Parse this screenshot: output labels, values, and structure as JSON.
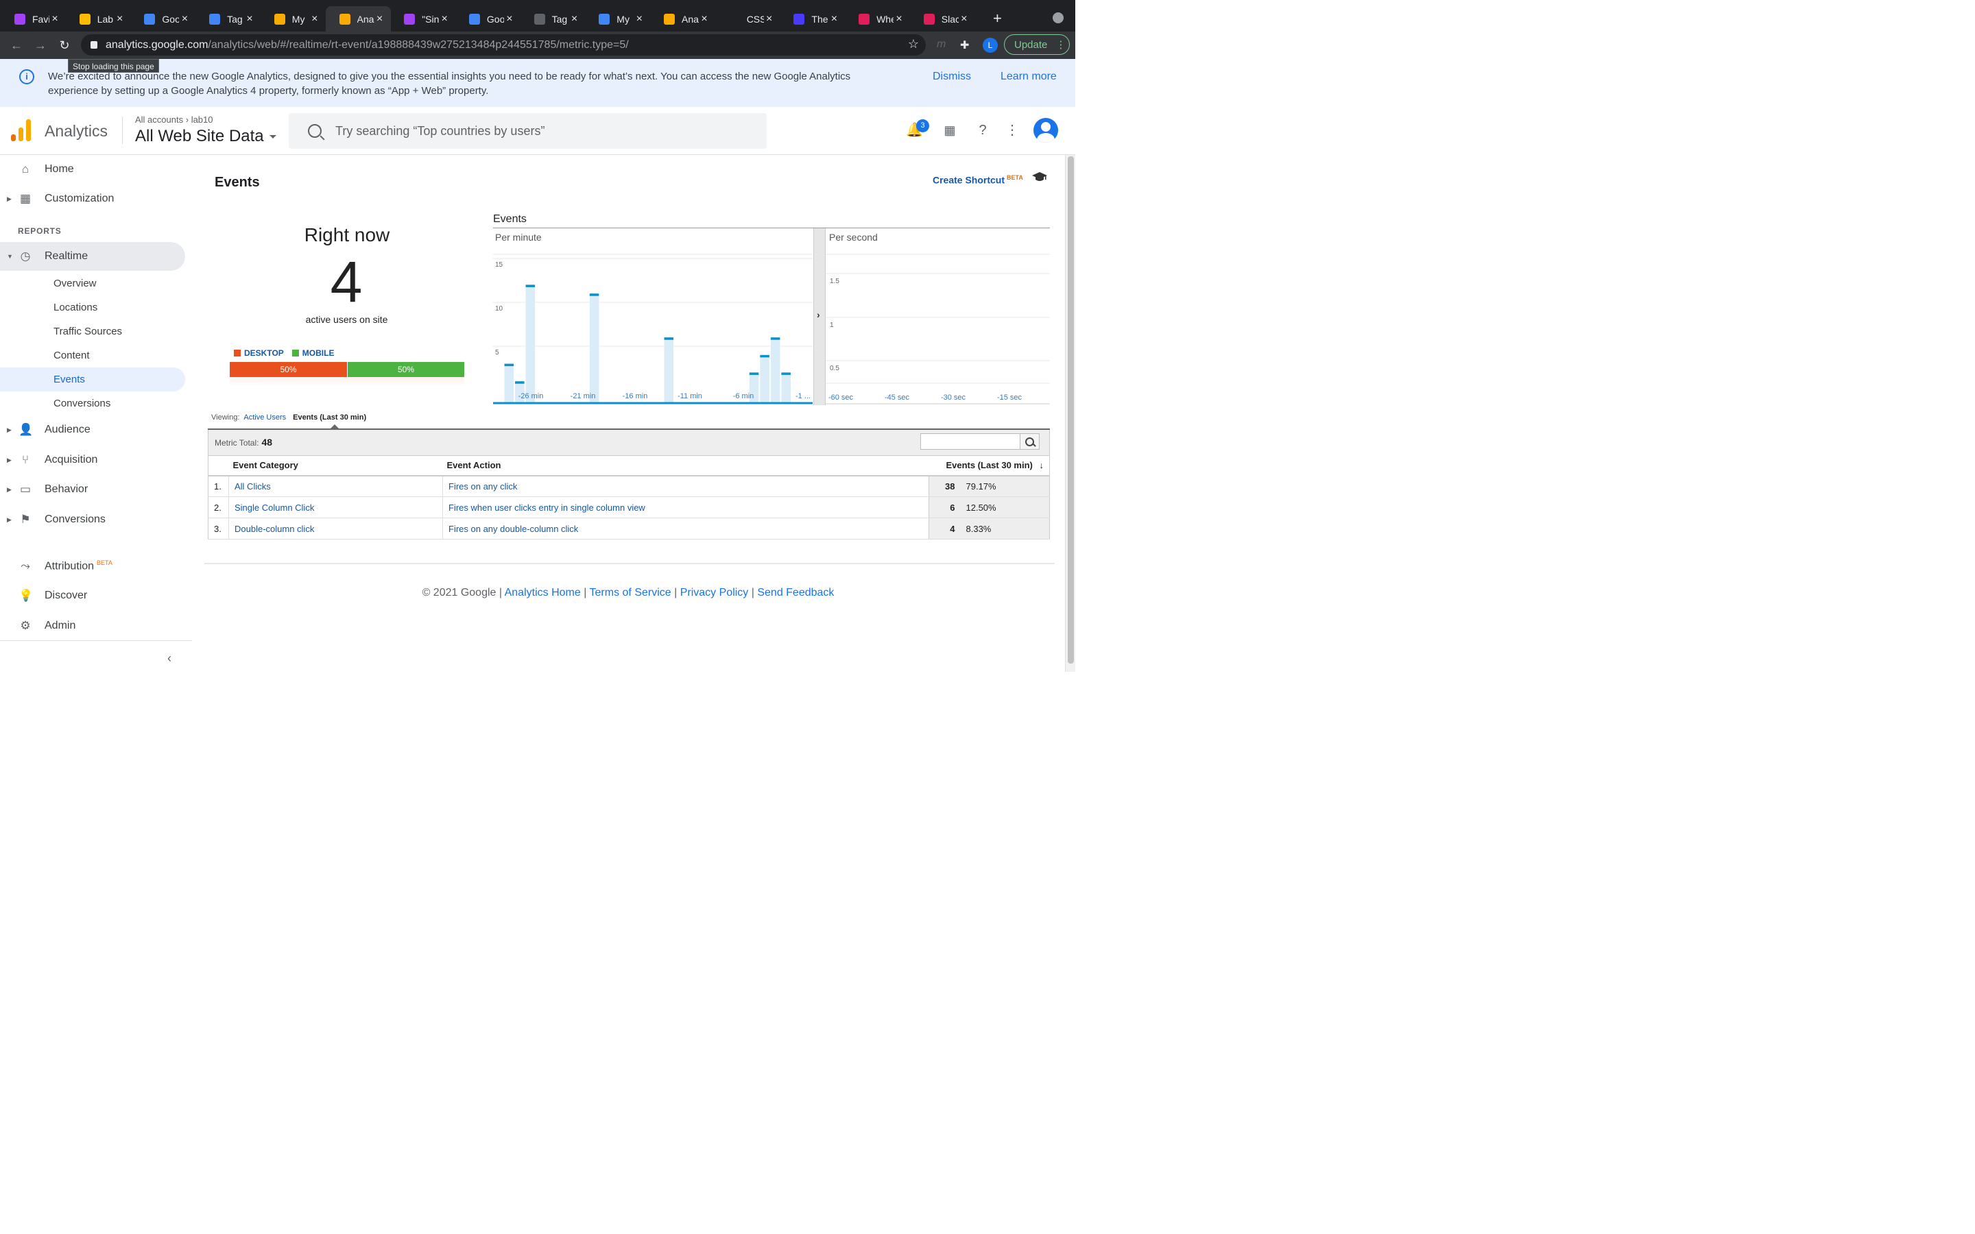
{
  "browser": {
    "tabs": [
      {
        "title": "Favi",
        "color": "#a142f4"
      },
      {
        "title": "Lab",
        "color": "#fbbc04"
      },
      {
        "title": "Goo",
        "color": "#4285f4"
      },
      {
        "title": "Tag",
        "color": "#4285f4"
      },
      {
        "title": "My",
        "color": "#f9ab00"
      },
      {
        "title": "Anal",
        "color": "#f9ab00",
        "active": true
      },
      {
        "title": "\"Sin",
        "color": "#a142f4"
      },
      {
        "title": "Goo",
        "color": "#4285f4"
      },
      {
        "title": "Tag",
        "color": "#5f6368"
      },
      {
        "title": "My",
        "color": "#4285f4"
      },
      {
        "title": "Anal",
        "color": "#f9ab00"
      },
      {
        "title": "CSS",
        "color": "#202124"
      },
      {
        "title": "The",
        "color": "#4a3aff"
      },
      {
        "title": "Whe",
        "color": "#e01e5a"
      },
      {
        "title": "Slac",
        "color": "#e01e5a"
      }
    ],
    "url_host": "analytics.google.com",
    "url_path": "/analytics/web/#/realtime/rt-event/a198888439w275213484p244551785/metric.type=5/",
    "tooltip": "Stop loading this page",
    "profile_initial": "L",
    "update_label": "Update"
  },
  "banner": {
    "text": "We’re excited to announce the new Google Analytics, designed to give you the essential insights you need to be ready for what’s next. You can access the new Google Analytics experience by setting up a Google Analytics 4 property, formerly known as “App + Web” property.",
    "dismiss": "Dismiss",
    "learn_more": "Learn more"
  },
  "header": {
    "product": "Analytics",
    "breadcrumb_root": "All accounts",
    "breadcrumb_account": "lab10",
    "property": "All Web Site Data",
    "search_placeholder": "Try searching “Top countries by users”",
    "notifications_count": "3"
  },
  "sidebar": {
    "home": "Home",
    "customization": "Customization",
    "reports_heading": "REPORTS",
    "realtime": "Realtime",
    "realtime_items": [
      "Overview",
      "Locations",
      "Traffic Sources",
      "Content",
      "Events",
      "Conversions"
    ],
    "selected": "Events",
    "audience": "Audience",
    "acquisition": "Acquisition",
    "behavior": "Behavior",
    "conversions": "Conversions",
    "attribution": "Attribution",
    "attribution_badge": "BETA",
    "discover": "Discover",
    "admin": "Admin"
  },
  "main": {
    "title": "Events",
    "create_shortcut": "Create Shortcut",
    "create_shortcut_badge": "BETA",
    "right_now": "Right now",
    "active_users": "4",
    "active_users_label": "active users on site",
    "device_legend": [
      {
        "label": "DESKTOP",
        "color": "#e8501e"
      },
      {
        "label": "MOBILE",
        "color": "#4db340"
      }
    ],
    "device_split": [
      {
        "label": "50%",
        "value": 50,
        "color": "#e8501e"
      },
      {
        "label": "50%",
        "value": 50,
        "color": "#4db340"
      }
    ],
    "viewing_label": "Viewing:",
    "viewing_link": "Active Users",
    "viewing_current": "Events (Last 30 min)",
    "metric_total_label": "Metric Total:",
    "metric_total": "48"
  },
  "chart_data": {
    "type": "bar",
    "title": "Events",
    "panes": [
      {
        "name": "Per minute",
        "y_ticks": [
          "15",
          "10",
          "5"
        ],
        "ylim": [
          0,
          15
        ],
        "x_labels": [
          "-26 min",
          "-21 min",
          "-16 min",
          "-11 min",
          "-6 min",
          "-1 ..."
        ],
        "values": [
          0,
          3,
          1,
          12,
          0,
          0,
          0,
          0,
          0,
          11,
          0,
          0,
          0,
          0,
          0,
          0,
          6,
          0,
          0,
          0,
          0,
          0,
          0,
          0,
          2,
          4,
          6,
          2,
          0,
          0
        ]
      },
      {
        "name": "Per second",
        "y_ticks": [
          "1.5",
          "1",
          "0.5"
        ],
        "ylim": [
          0,
          2
        ],
        "x_labels": [
          "-60 sec",
          "-45 sec",
          "-30 sec",
          "-15 sec"
        ],
        "values": []
      }
    ]
  },
  "table": {
    "columns": [
      "Event Category",
      "Event Action",
      "Events (Last 30 min)"
    ],
    "rows": [
      {
        "rank": "1.",
        "category": "All Clicks",
        "action": "Fires on any click",
        "events": "38",
        "pct": "79.17%"
      },
      {
        "rank": "2.",
        "category": "Single Column Click",
        "action": "Fires when user clicks entry in single column view",
        "events": "6",
        "pct": "12.50%"
      },
      {
        "rank": "3.",
        "category": "Double-column click",
        "action": "Fires on any double-column click",
        "events": "4",
        "pct": "8.33%"
      }
    ]
  },
  "footer": {
    "copyright": "© 2021 Google",
    "links": [
      "Analytics Home",
      "Terms of Service",
      "Privacy Policy",
      "Send Feedback"
    ]
  },
  "colors": {
    "link": "#1558a7",
    "chart_bar": "#0b90c9",
    "chart_bg_bar": "#d9ecf7"
  }
}
